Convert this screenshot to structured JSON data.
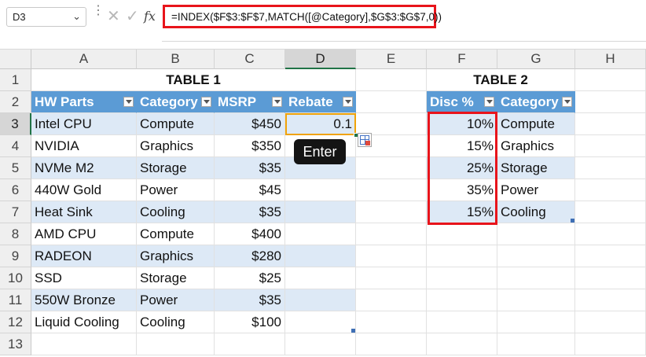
{
  "formula_bar": {
    "name_box": "D3",
    "cancel_icon": "x-icon",
    "enter_icon": "check-icon",
    "fx_label": "fx",
    "formula": "=INDEX($F$3:$F$7,MATCH([@Category],$G$3:$G$7,0))"
  },
  "columns": [
    "A",
    "B",
    "C",
    "D",
    "E",
    "F",
    "G",
    "H"
  ],
  "rows": [
    "1",
    "2",
    "3",
    "4",
    "5",
    "6",
    "7",
    "8",
    "9",
    "10",
    "11",
    "12",
    "13"
  ],
  "table1": {
    "title": "TABLE 1",
    "headers": [
      "HW Parts",
      "Category",
      "MSRP",
      "Rebate"
    ],
    "rows": [
      {
        "part": "Intel CPU",
        "category": "Compute",
        "msrp": "$450",
        "rebate": "0.1"
      },
      {
        "part": "NVIDIA",
        "category": "Graphics",
        "msrp": "$350",
        "rebate": ""
      },
      {
        "part": "NVMe M2",
        "category": "Storage",
        "msrp": "$35",
        "rebate": ""
      },
      {
        "part": "440W Gold",
        "category": "Power",
        "msrp": "$45",
        "rebate": ""
      },
      {
        "part": "Heat Sink",
        "category": "Cooling",
        "msrp": "$35",
        "rebate": ""
      },
      {
        "part": "AMD CPU",
        "category": "Compute",
        "msrp": "$400",
        "rebate": ""
      },
      {
        "part": "RADEON",
        "category": "Graphics",
        "msrp": "$280",
        "rebate": ""
      },
      {
        "part": "SSD",
        "category": "Storage",
        "msrp": "$25",
        "rebate": ""
      },
      {
        "part": "550W Bronze",
        "category": "Power",
        "msrp": "$35",
        "rebate": ""
      },
      {
        "part": "Liquid Cooling",
        "category": "Cooling",
        "msrp": "$100",
        "rebate": ""
      }
    ]
  },
  "table2": {
    "title": "TABLE 2",
    "headers": [
      "Disc %",
      "Category"
    ],
    "rows": [
      {
        "disc": "10%",
        "category": "Compute"
      },
      {
        "disc": "15%",
        "category": "Graphics"
      },
      {
        "disc": "25%",
        "category": "Storage"
      },
      {
        "disc": "35%",
        "category": "Power"
      },
      {
        "disc": "15%",
        "category": "Cooling"
      }
    ]
  },
  "tooltip": "Enter",
  "colors": {
    "header_blue": "#5b9bd5",
    "band": "#dde9f6",
    "highlight_red": "#e8141b",
    "active_orange": "#f0a30a"
  }
}
